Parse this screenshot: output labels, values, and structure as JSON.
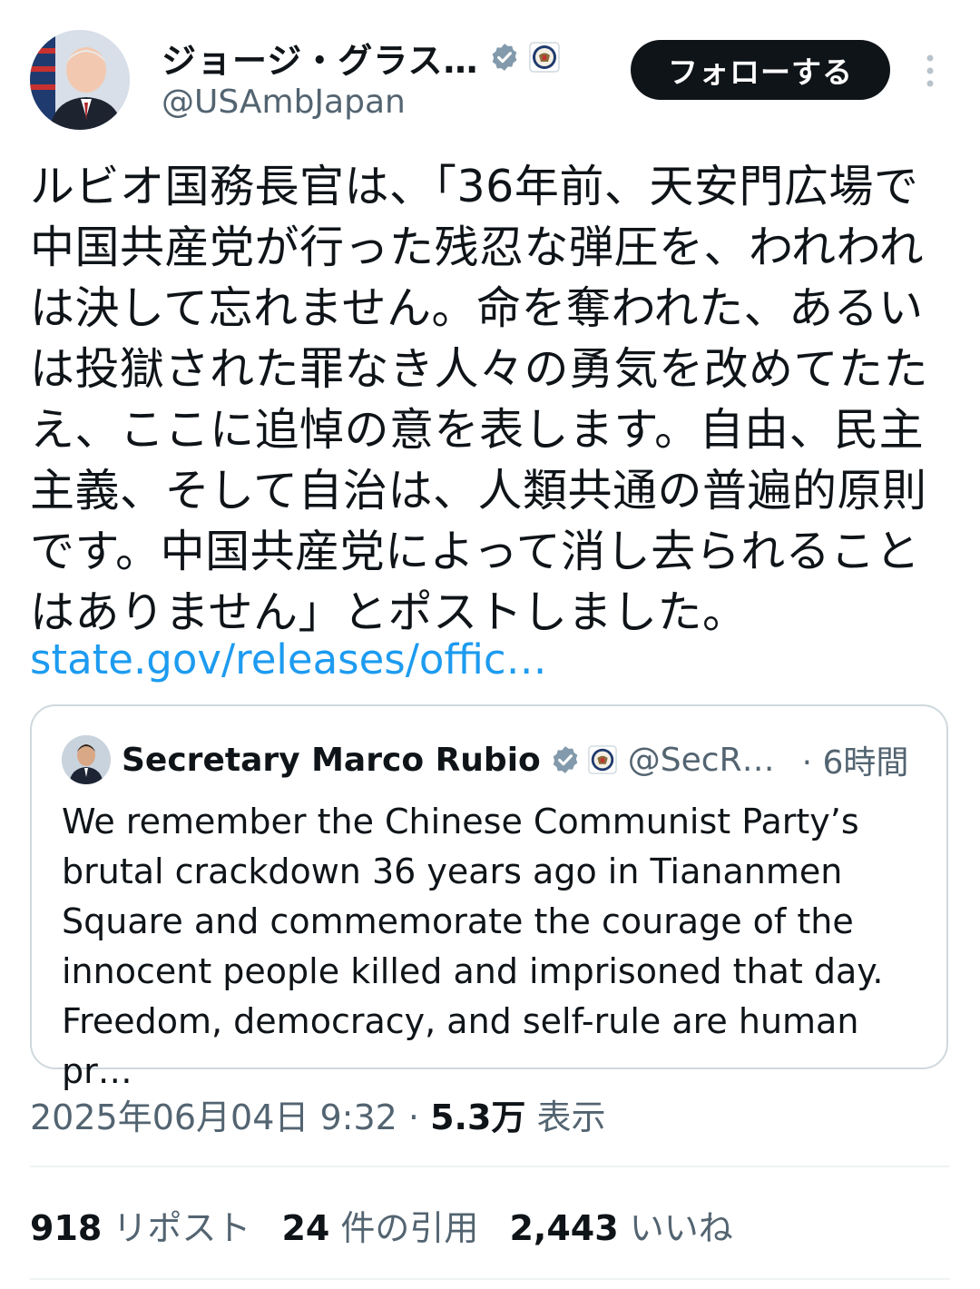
{
  "author": {
    "display_name": "ジョージ・グラス…",
    "handle": "@USAmbJapan"
  },
  "follow_label": "フォローする",
  "tweet": {
    "text": "ルビオ国務長官は、「36年前、天安門広場で\n中国共産党が行った残忍な弾圧を、われわれ\nは決して忘れません。命を奪われた、あるい\nは投獄された罪なき人々の勇気を改めてたた\nえ、ここに追悼の意を表します。自由、民主\n主義、そして自治は、人類共通の普遍的原則\nです。中国共産党によって消し去られること\nはありません」とポストしました。",
    "link": "state.gov/releases/offic…"
  },
  "quoted": {
    "name": "Secretary Marco Rubio",
    "handle": "@SecR…",
    "time": "· 6時間",
    "text": "We remember the Chinese Communist Party’s\nbrutal crackdown 36 years ago in Tiananmen\nSquare and commemorate the courage of the\ninnocent people killed and imprisoned that day.\nFreedom, democracy, and self-rule are human pr…"
  },
  "meta": {
    "datetime": "2025年06月04日 9:32",
    "separator": "·",
    "views": "5.3万",
    "views_label": "表示"
  },
  "stats": {
    "reposts_count": "918",
    "reposts_label": "リポスト",
    "quotes_count": "24",
    "quotes_label": "件の引用",
    "likes_count": "2,443",
    "likes_label": "いいね"
  },
  "colors": {
    "link": "#1d9bf0",
    "verified": "#829aab",
    "muted_text": "#536471",
    "button_bg": "#0f1419"
  },
  "icons": [
    "verified-badge-icon",
    "state-department-seal-icon",
    "more-options-icon"
  ]
}
